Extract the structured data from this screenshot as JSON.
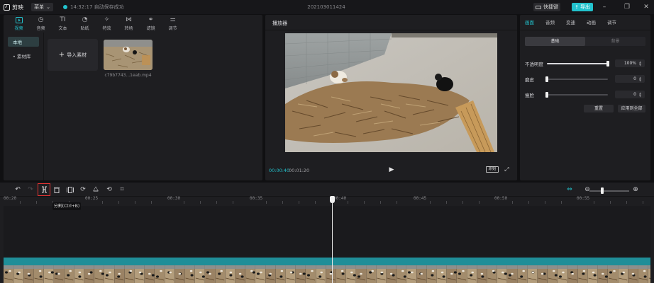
{
  "app": {
    "name": "剪映",
    "menu_label": "菜单",
    "save_status": "14:32:17 自动保存成功",
    "project_title": "202103011424",
    "shortcut_label": "快捷键",
    "export_label": "导出"
  },
  "media_tabs": [
    {
      "label": "视频",
      "icon": "video-icon",
      "glyph": "▶"
    },
    {
      "label": "音频",
      "icon": "audio-icon",
      "glyph": "◷"
    },
    {
      "label": "文本",
      "icon": "text-icon",
      "glyph": "TI"
    },
    {
      "label": "贴纸",
      "icon": "sticker-icon",
      "glyph": "◔"
    },
    {
      "label": "特效",
      "icon": "effect-icon",
      "glyph": "✧"
    },
    {
      "label": "转场",
      "icon": "transition-icon",
      "glyph": "⋈"
    },
    {
      "label": "滤镜",
      "icon": "filter-icon",
      "glyph": "⚭"
    },
    {
      "label": "调节",
      "icon": "adjust-icon",
      "glyph": "⚌"
    }
  ],
  "side_nav": [
    {
      "label": "本地"
    },
    {
      "label": "• 素材库"
    }
  ],
  "media": {
    "import_label": "导入素材",
    "clip_name": "c79b7743...1eab.mp4"
  },
  "player": {
    "title": "播放器",
    "current_time": "00:00:40",
    "total_time": "00:01:20",
    "ratio_label": "原始"
  },
  "inspector": {
    "tabs": [
      "画面",
      "音频",
      "变速",
      "动画",
      "调节"
    ],
    "segments": [
      "基础",
      "背景"
    ],
    "props": [
      {
        "label": "不透明度",
        "value": "100%",
        "level": 1.0
      },
      {
        "label": "磨皮",
        "value": "0",
        "level": 0.0
      },
      {
        "label": "瘦脸",
        "value": "0",
        "level": 0.0
      }
    ],
    "reset_label": "重置",
    "apply_all_label": "应用到全部"
  },
  "timeline": {
    "split_tooltip": "分割(Ctrl+B)",
    "ticks": [
      "00:20",
      "00:25",
      "00:30",
      "00:35",
      "00:40",
      "00:45",
      "00:50",
      "00:55"
    ],
    "zoom_level": 0.3
  }
}
